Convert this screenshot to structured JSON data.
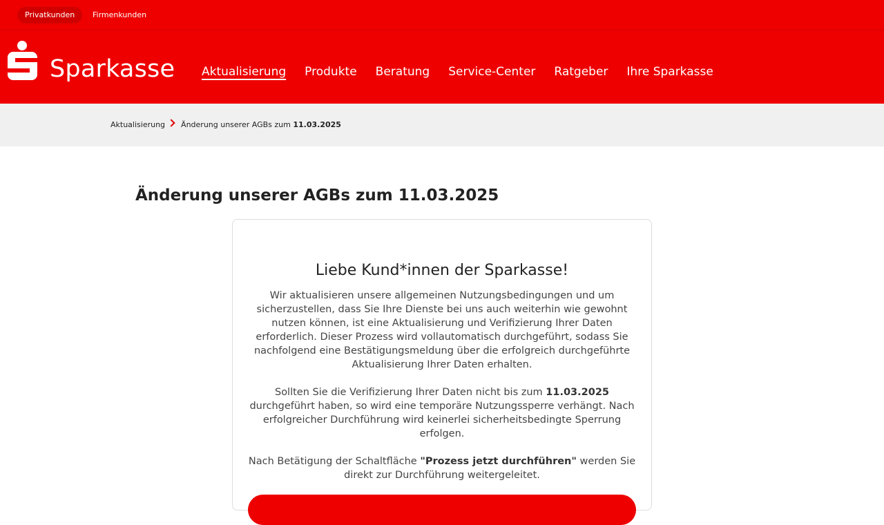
{
  "audience": {
    "private_label": "Privatkunden",
    "business_label": "Firmenkunden"
  },
  "brand": {
    "name": "Sparkasse",
    "color": "#ee0000"
  },
  "nav": {
    "items": [
      "Aktualisierung",
      "Produkte",
      "Beratung",
      "Service-Center",
      "Ratgeber",
      "Ihre Sparkasse"
    ],
    "active": "Aktualisierung"
  },
  "breadcrumb": {
    "parent": "Aktualisierung",
    "current_prefix": "Änderung unserer AGBs zum ",
    "current_date": "11.03.2025"
  },
  "page": {
    "title": "Änderung unserer AGBs zum 11.03.2025"
  },
  "card": {
    "heading": "Liebe Kund*innen der Sparkasse!",
    "paragraph1": "Wir aktualisieren unsere allgemeinen Nutzungsbedingungen und um sicherzustellen, dass Sie Ihre Dienste bei uns auch weiterhin wie gewohnt nutzen können, ist eine Aktualisierung und Verifizierung Ihrer Daten erforderlich. Dieser Prozess wird vollautomatisch durchgeführt, sodass Sie nachfolgend eine Bestätigungsmeldung über die erfolgreich durchgeführte Aktualisierung Ihrer Daten erhalten.",
    "paragraph2_before": "Sollten Sie die Verifizierung Ihrer Daten nicht bis zum ",
    "paragraph2_date": "11.03.2025",
    "paragraph2_after": " durchgeführt haben, so wird eine temporäre Nutzungssperre verhängt. Nach erfolgreicher Durchführung wird keinerlei sicherheitsbedingte Sperrung erfolgen.",
    "paragraph3_before": "Nach Betätigung der Schaltfläche ",
    "paragraph3_button_ref": "\"Prozess jetzt durchführen\"",
    "paragraph3_after": " werden Sie direkt zur Durchführung weitergeleitet.",
    "cta_label": ""
  }
}
